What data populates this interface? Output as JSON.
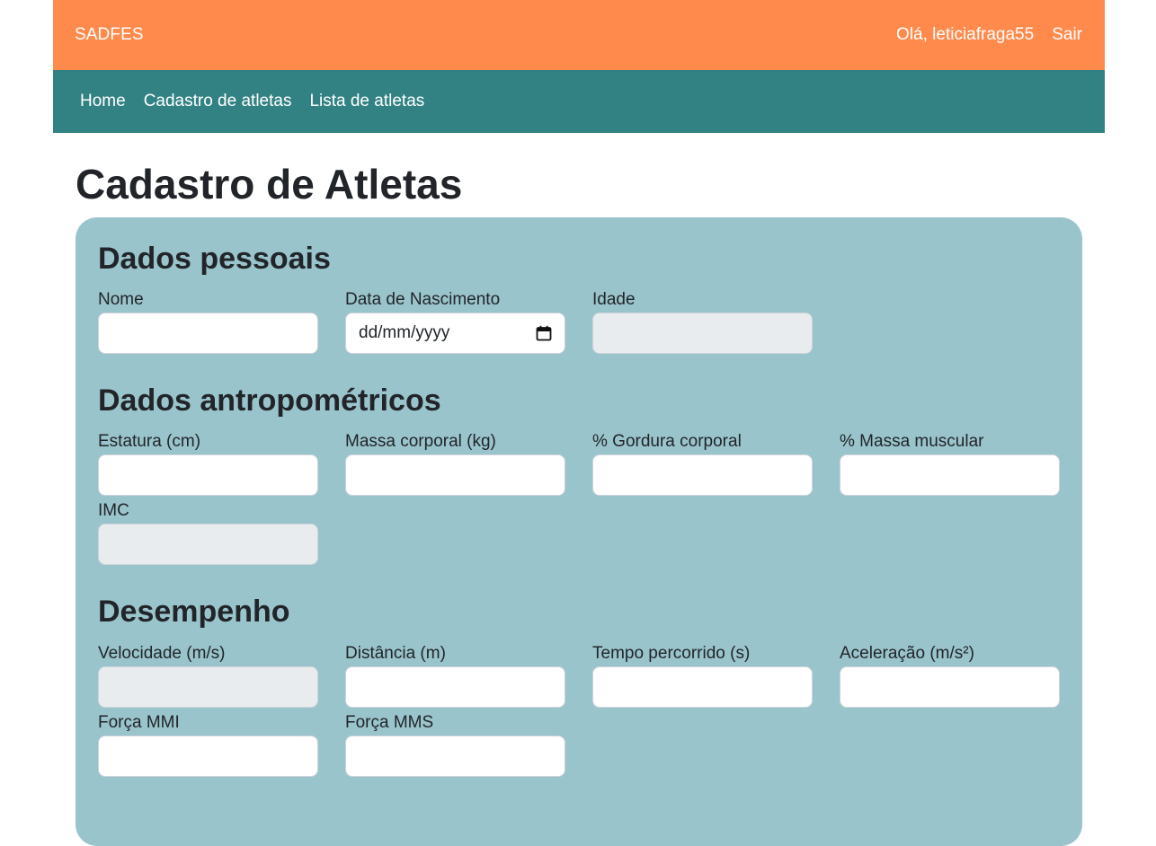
{
  "header": {
    "brand": "SADFES",
    "greeting": "Olá, leticiafraga55",
    "logout": "Sair"
  },
  "nav": {
    "items": [
      {
        "label": "Home"
      },
      {
        "label": "Cadastro de atletas"
      },
      {
        "label": "Lista de atletas"
      }
    ]
  },
  "page": {
    "title": "Cadastro de Atletas"
  },
  "sections": {
    "personal": {
      "title": "Dados pessoais",
      "fields": {
        "nome": {
          "label": "Nome",
          "value": ""
        },
        "nascimento": {
          "label": "Data de Nascimento",
          "placeholder": "dd/mm/yyyy"
        },
        "idade": {
          "label": "Idade",
          "value": ""
        }
      }
    },
    "anthropometric": {
      "title": "Dados antropométricos",
      "fields": {
        "estatura": {
          "label": "Estatura (cm)",
          "value": ""
        },
        "massa": {
          "label": "Massa corporal (kg)",
          "value": ""
        },
        "gordura": {
          "label": "% Gordura corporal",
          "value": ""
        },
        "muscular": {
          "label": "% Massa muscular",
          "value": ""
        },
        "imc": {
          "label": "IMC",
          "value": ""
        }
      }
    },
    "performance": {
      "title": "Desempenho",
      "fields": {
        "velocidade": {
          "label": "Velocidade (m/s)",
          "value": ""
        },
        "distancia": {
          "label": "Distância (m)",
          "value": ""
        },
        "tempo": {
          "label": "Tempo percorrido (s)",
          "value": ""
        },
        "aceleracao": {
          "label": "Aceleração (m/s²)",
          "value": ""
        },
        "forca_mmi": {
          "label": "Força MMI",
          "value": ""
        },
        "forca_mms": {
          "label": "Força MMS",
          "value": ""
        }
      }
    }
  },
  "colors": {
    "topbar": "#ff8a4c",
    "navbar": "#328283",
    "card": "#9ac4cc",
    "disabled_input": "#e9ecef"
  },
  "icons": {
    "date_picker": "calendar-icon"
  }
}
